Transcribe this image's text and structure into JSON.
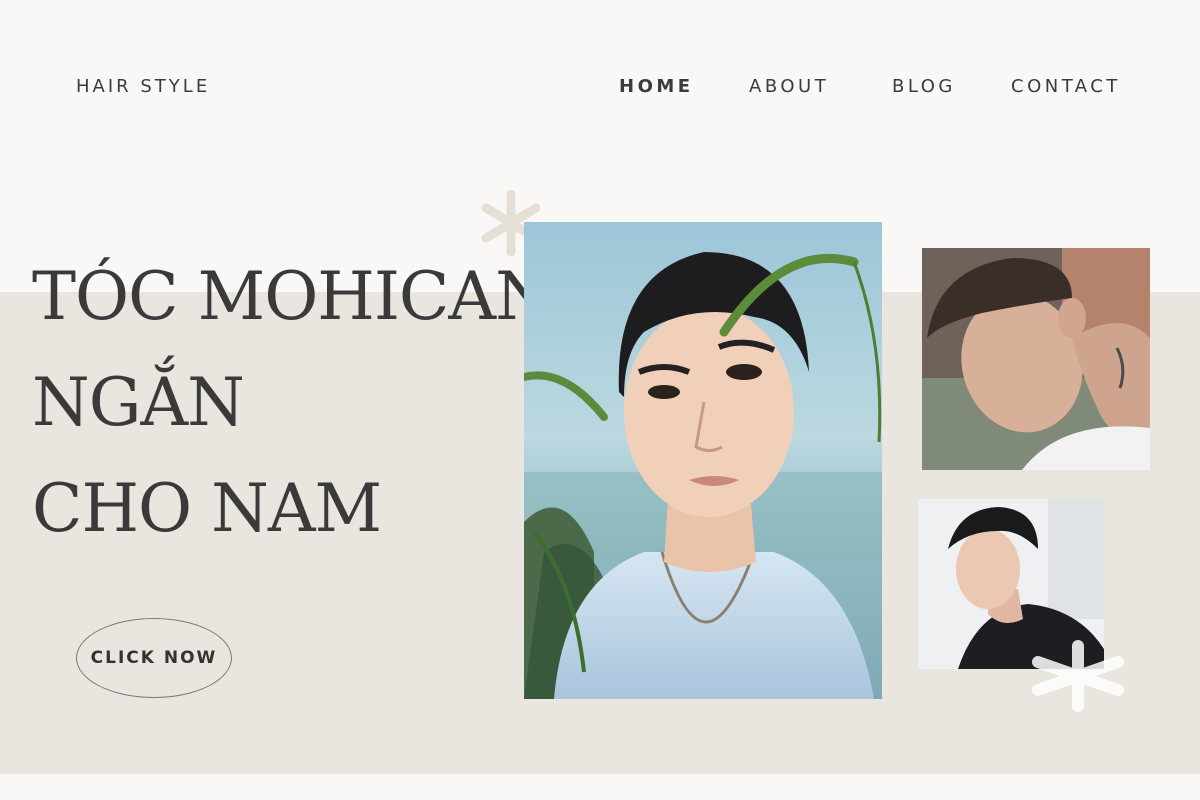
{
  "brand": "HAIR STYLE",
  "nav": {
    "home": "HOME",
    "about": "ABOUT",
    "blog": "BLOG",
    "contact": "CONTACT"
  },
  "hero": {
    "title_lines": [
      "TÓC MOHICAN",
      "NGẮN",
      "CHO NAM"
    ],
    "cta": "CLICK NOW"
  },
  "colors": {
    "background": "#f9f8f6",
    "band": "#e9e6e0",
    "text": "#3a3a3a",
    "asterisk_top": "#e6dfd6",
    "asterisk_bottom": "#ffffff"
  },
  "decorations": [
    "asterisk-icon",
    "asterisk-icon"
  ]
}
